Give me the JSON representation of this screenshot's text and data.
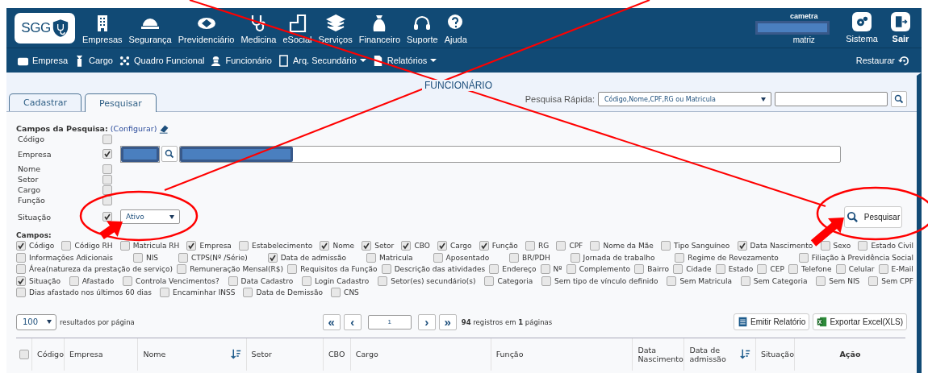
{
  "header": {
    "logo": "SGG",
    "menu": [
      {
        "label": "Empresas"
      },
      {
        "label": "Segurança"
      },
      {
        "label": "Previdenciário"
      },
      {
        "label": "Medicina"
      },
      {
        "label": "eSocial"
      },
      {
        "label": "Serviços"
      },
      {
        "label": "Financeiro"
      },
      {
        "label": "Suporte"
      },
      {
        "label": "Ajuda"
      }
    ],
    "user": {
      "name": "cametra",
      "unit": "matriz"
    },
    "actions": [
      {
        "label": "Sistema",
        "kind": "settings"
      },
      {
        "label": "Sair",
        "kind": "exit"
      }
    ]
  },
  "subnav": {
    "items": [
      {
        "label": "Empresa",
        "dropdown": false
      },
      {
        "label": "Cargo",
        "dropdown": false
      },
      {
        "label": "Quadro Funcional",
        "dropdown": false
      },
      {
        "label": "Funcionário",
        "dropdown": false
      },
      {
        "label": "Arq. Secundário",
        "dropdown": true
      },
      {
        "label": "Relatórios",
        "dropdown": true
      }
    ],
    "restore": "Restaurar"
  },
  "page_title": "FUNCIONÁRIO",
  "tabs": [
    {
      "label": "Cadastrar",
      "selected": false
    },
    {
      "label": "Pesquisar",
      "selected": true
    }
  ],
  "quick_search": {
    "label": "Pesquisa Rápida:",
    "option": "Código,Nome,CPF,RG ou Matricula"
  },
  "search_fields": {
    "title": "Campos da Pesquisa:",
    "configure": "(Configurar)",
    "rows": [
      {
        "label": "Código",
        "checked": false,
        "kind": "plain"
      },
      {
        "label": "Empresa",
        "checked": true,
        "kind": "company"
      },
      {
        "label": "Nome",
        "checked": false,
        "kind": "plain"
      },
      {
        "label": "Setor",
        "checked": false,
        "kind": "plain"
      },
      {
        "label": "Cargo",
        "checked": false,
        "kind": "plain"
      },
      {
        "label": "Função",
        "checked": false,
        "kind": "plain"
      },
      {
        "label": "Situação",
        "checked": true,
        "kind": "select",
        "value": "Ativo"
      }
    ]
  },
  "search_button": "Pesquisar",
  "columns_title": "Campos:",
  "columns_rows": [
    [
      {
        "label": "Código",
        "checked": true
      },
      {
        "label": "Código RH",
        "checked": false
      },
      {
        "label": "Matricula RH",
        "checked": false
      },
      {
        "label": "Empresa",
        "checked": true
      },
      {
        "label": "Estabelecimento",
        "checked": false
      },
      {
        "label": "Nome",
        "checked": true
      },
      {
        "label": "Setor",
        "checked": true
      },
      {
        "label": "CBO",
        "checked": true
      },
      {
        "label": "Cargo",
        "checked": true
      },
      {
        "label": "Função",
        "checked": true
      },
      {
        "label": "RG",
        "checked": false
      },
      {
        "label": "CPF",
        "checked": false
      },
      {
        "label": "Nome da Mãe",
        "checked": false
      },
      {
        "label": "Tipo Sanguíneo",
        "checked": false
      },
      {
        "label": "Data Nascimento",
        "checked": true
      },
      {
        "label": "Sexo",
        "checked": false
      },
      {
        "label": "Estado Civil",
        "checked": false
      }
    ],
    [
      {
        "label": "Informações Adicionais",
        "checked": false
      },
      {
        "label": "NIS",
        "checked": false
      },
      {
        "label": "CTPS(Nº /Série)",
        "checked": false
      },
      {
        "label": "Data de admissão",
        "checked": true
      },
      {
        "label": "Matricula",
        "checked": false
      },
      {
        "label": "Aposentado",
        "checked": false
      },
      {
        "label": "BR/PDH",
        "checked": false
      },
      {
        "label": "Jornada de trabalho",
        "checked": false
      },
      {
        "label": "Regime de Revezamento",
        "checked": false
      },
      {
        "label": "Filiação à Previdência Social",
        "checked": false
      }
    ],
    [
      {
        "label": "Área(natureza da prestação de serviço)",
        "checked": false
      },
      {
        "label": "Remuneração Mensal(R$)",
        "checked": false
      },
      {
        "label": "Requisitos da Função",
        "checked": false
      },
      {
        "label": "Descrição das atividades",
        "checked": false
      },
      {
        "label": "Endereço",
        "checked": false
      },
      {
        "label": "Nº",
        "checked": false
      },
      {
        "label": "Complemento",
        "checked": false
      },
      {
        "label": "Bairro",
        "checked": false
      },
      {
        "label": "Cidade",
        "checked": false
      },
      {
        "label": "Estado",
        "checked": false
      },
      {
        "label": "CEP",
        "checked": false
      },
      {
        "label": "Telefone",
        "checked": false
      },
      {
        "label": "Celular",
        "checked": false
      },
      {
        "label": "E-Mail",
        "checked": false
      }
    ],
    [
      {
        "label": "Situação",
        "checked": true
      },
      {
        "label": "Afastado",
        "checked": false
      },
      {
        "label": "Controla Vencimentos?",
        "checked": false
      },
      {
        "label": "Data Cadastro",
        "checked": false
      },
      {
        "label": "Login Cadastro",
        "checked": false
      },
      {
        "label": "Setor(es) secundário(s)",
        "checked": false
      },
      {
        "label": "Categoria",
        "checked": false
      },
      {
        "label": "Sem tipo de vínculo definido",
        "checked": false
      },
      {
        "label": "Sem Matricula",
        "checked": false
      },
      {
        "label": "Sem Categoria",
        "checked": false
      },
      {
        "label": "Sem NIS",
        "checked": false
      },
      {
        "label": "Sem CPF",
        "checked": false
      }
    ],
    [
      {
        "label": "Dias afastado nos últimos 60 dias",
        "checked": false
      },
      {
        "label": "Encaminhar INSS",
        "checked": false
      },
      {
        "label": "Data de Demissão",
        "checked": false
      },
      {
        "label": "CNS",
        "checked": false
      }
    ]
  ],
  "pager": {
    "page_size": "100",
    "page_size_label": "resultados por página",
    "page": "1",
    "first": "«",
    "prev": "‹",
    "next": "›",
    "last": "»",
    "summary": "**94** registros em **1** páginas"
  },
  "report_button": "Emitir Relatório",
  "excel_button": "Exportar Excel(XLS)",
  "table": {
    "select_all": {
      "checked": false
    },
    "columns": [
      {
        "label": "Código",
        "sort": false,
        "bold": false
      },
      {
        "label": "Empresa",
        "sort": false,
        "bold": false
      },
      {
        "label": "Nome",
        "sort": true,
        "bold": false
      },
      {
        "label": "Setor",
        "sort": false,
        "bold": false
      },
      {
        "label": "CBO",
        "sort": false,
        "bold": false
      },
      {
        "label": "Cargo",
        "sort": false,
        "bold": false
      },
      {
        "label": "Função",
        "sort": false,
        "bold": false
      },
      {
        "label": "Data Nascimento",
        "sort": false,
        "bold": false
      },
      {
        "label": "Data de admissão",
        "sort": true,
        "bold": false
      },
      {
        "label": "Situação",
        "sort": false,
        "bold": false
      },
      {
        "label": "Ação",
        "sort": false,
        "bold": true
      }
    ]
  },
  "annotation_marks": [
    {
      "kind": "line"
    },
    {
      "kind": "line"
    },
    {
      "kind": "ellipse"
    },
    {
      "kind": "ellipse"
    },
    {
      "kind": "arrow"
    },
    {
      "kind": "arrow"
    }
  ]
}
